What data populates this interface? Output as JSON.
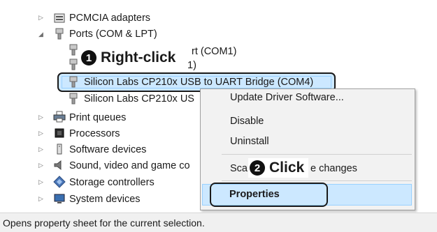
{
  "tree": {
    "items": [
      {
        "label": "PCMCIA adapters",
        "icon": "pcmcia-icon"
      },
      {
        "label": "Ports (COM & LPT)",
        "icon": "port-icon"
      },
      {
        "label": "rt (COM1)",
        "icon": "port-device-icon"
      },
      {
        "label": "1)",
        "icon": "port-device-icon"
      },
      {
        "label": "Silicon Labs CP210x USB to UART Bridge (COM4)",
        "icon": "port-device-icon"
      },
      {
        "label": "Silicon Labs CP210x US",
        "icon": "port-device-icon"
      },
      {
        "label": "Print queues",
        "icon": "printer-icon"
      },
      {
        "label": "Processors",
        "icon": "processor-icon"
      },
      {
        "label": "Software devices",
        "icon": "software-device-icon"
      },
      {
        "label": "Sound, video and game co",
        "icon": "speaker-icon"
      },
      {
        "label": "Storage controllers",
        "icon": "storage-icon"
      },
      {
        "label": "System devices",
        "icon": "system-devices-icon"
      }
    ]
  },
  "context_menu": {
    "items": [
      {
        "label": "Update Driver Software..."
      },
      {
        "label": "Disable"
      },
      {
        "label": "Uninstall"
      },
      {
        "label": "Sca"
      },
      {
        "label": "e changes"
      },
      {
        "label": "Properties"
      }
    ]
  },
  "callouts": {
    "right_click": {
      "number": "1",
      "text": "Right-click"
    },
    "click": {
      "number": "2",
      "text": "Click"
    }
  },
  "status_bar": {
    "text": "Opens property sheet for the current selection."
  },
  "colors": {
    "selection": "#cce8ff",
    "selection_border": "#99d1ff",
    "menu_bg": "#f2f2f2"
  }
}
